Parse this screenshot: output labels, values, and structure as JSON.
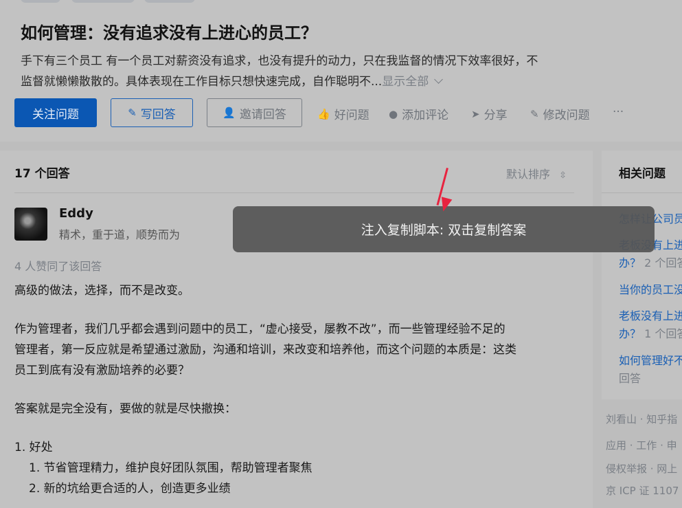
{
  "question": {
    "title": "如何管理：没有追求没有上进心的员工？",
    "description_line1": "手下有三个员工 有一个员工对薪资没有追求，也没有提升的动力，只在我监督的情况下效率很好，不",
    "description_line2": "监督就懒懒散散的。具体表现在工作目标只想快速完成，自作聪明不...",
    "show_all": "显示全部"
  },
  "actions": {
    "follow": "关注问题",
    "write": "写回答",
    "invite": "邀请回答",
    "good_question": "好问题",
    "comment": "添加评论",
    "share": "分享",
    "edit": "修改问题",
    "more": "···"
  },
  "answers": {
    "count_label": "17 个回答",
    "sort_label": "默认排序"
  },
  "answer": {
    "author": "Eddy",
    "bio": "精术，重于道，顺势而为",
    "votes": "4 人赞同了该回答",
    "p1": "高级的做法，选择，而不是改变。",
    "p2_l1": "作为管理者，我们几乎都会遇到问题中的员工，“虚心接受，屡教不改”，而一些管理经验不足的",
    "p2_l2": "管理者，第一反应就是希望通过激励，沟通和培训，来改变和培养他，而这个问题的本质是：这类",
    "p2_l3": "员工到底有没有激励培养的必要？",
    "p3": "答案就是完全没有，要做的就是尽快撤换：",
    "li1": "1. 好处",
    "li1_1": "1. 节省管理精力，维护良好团队氛围，帮助管理者聚焦",
    "li1_2": "2. 新的坑给更合适的人，创造更多业绩"
  },
  "sidebar": {
    "title": "相关问题",
    "links": [
      {
        "text": "怎样让公司员"
      },
      {
        "text": "老板没有上进",
        "text2": "办？",
        "sub": " 2 个回答"
      },
      {
        "text": "当你的员工没"
      },
      {
        "text": "老板没有上进",
        "text2": "办？",
        "sub": " 1 个回答"
      },
      {
        "text": "如何管理好不",
        "sub": "回答"
      }
    ],
    "footer": [
      "刘看山 · 知乎指",
      "应用 · 工作 · 申",
      "侵权举报 · 网上",
      "京 ICP 证 1107"
    ]
  },
  "toast": {
    "message": "注入复制脚本: 双击复制答案"
  },
  "colors": {
    "primary": "#0b57b3",
    "link": "#1a5fb4",
    "arrow": "#e8233f"
  }
}
